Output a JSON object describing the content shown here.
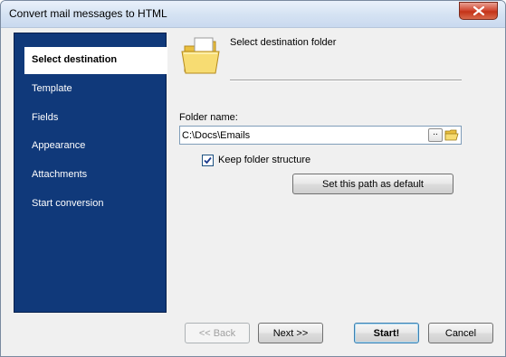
{
  "window": {
    "title": "Convert mail messages to HTML"
  },
  "sidebar": {
    "items": [
      {
        "label": "Select destination",
        "active": true
      },
      {
        "label": "Template"
      },
      {
        "label": "Fields"
      },
      {
        "label": "Appearance"
      },
      {
        "label": "Attachments"
      },
      {
        "label": "Start conversion"
      }
    ]
  },
  "header": {
    "title": "Select destination folder",
    "icon": "folder-icon"
  },
  "form": {
    "folder_label": "Folder name:",
    "folder_value": "C:\\Docs\\Emails",
    "browse_dots": "..",
    "keep_structure_label": "Keep folder structure",
    "keep_structure_checked": true,
    "set_default_label": "Set this path as default"
  },
  "footer": {
    "back_label": "<< Back",
    "next_label": "Next >>",
    "start_label": "Start!",
    "cancel_label": "Cancel"
  },
  "colors": {
    "sidebar_bg": "#10397a",
    "close_button": "#c43318",
    "folder_yellow": "#f4d35e"
  }
}
